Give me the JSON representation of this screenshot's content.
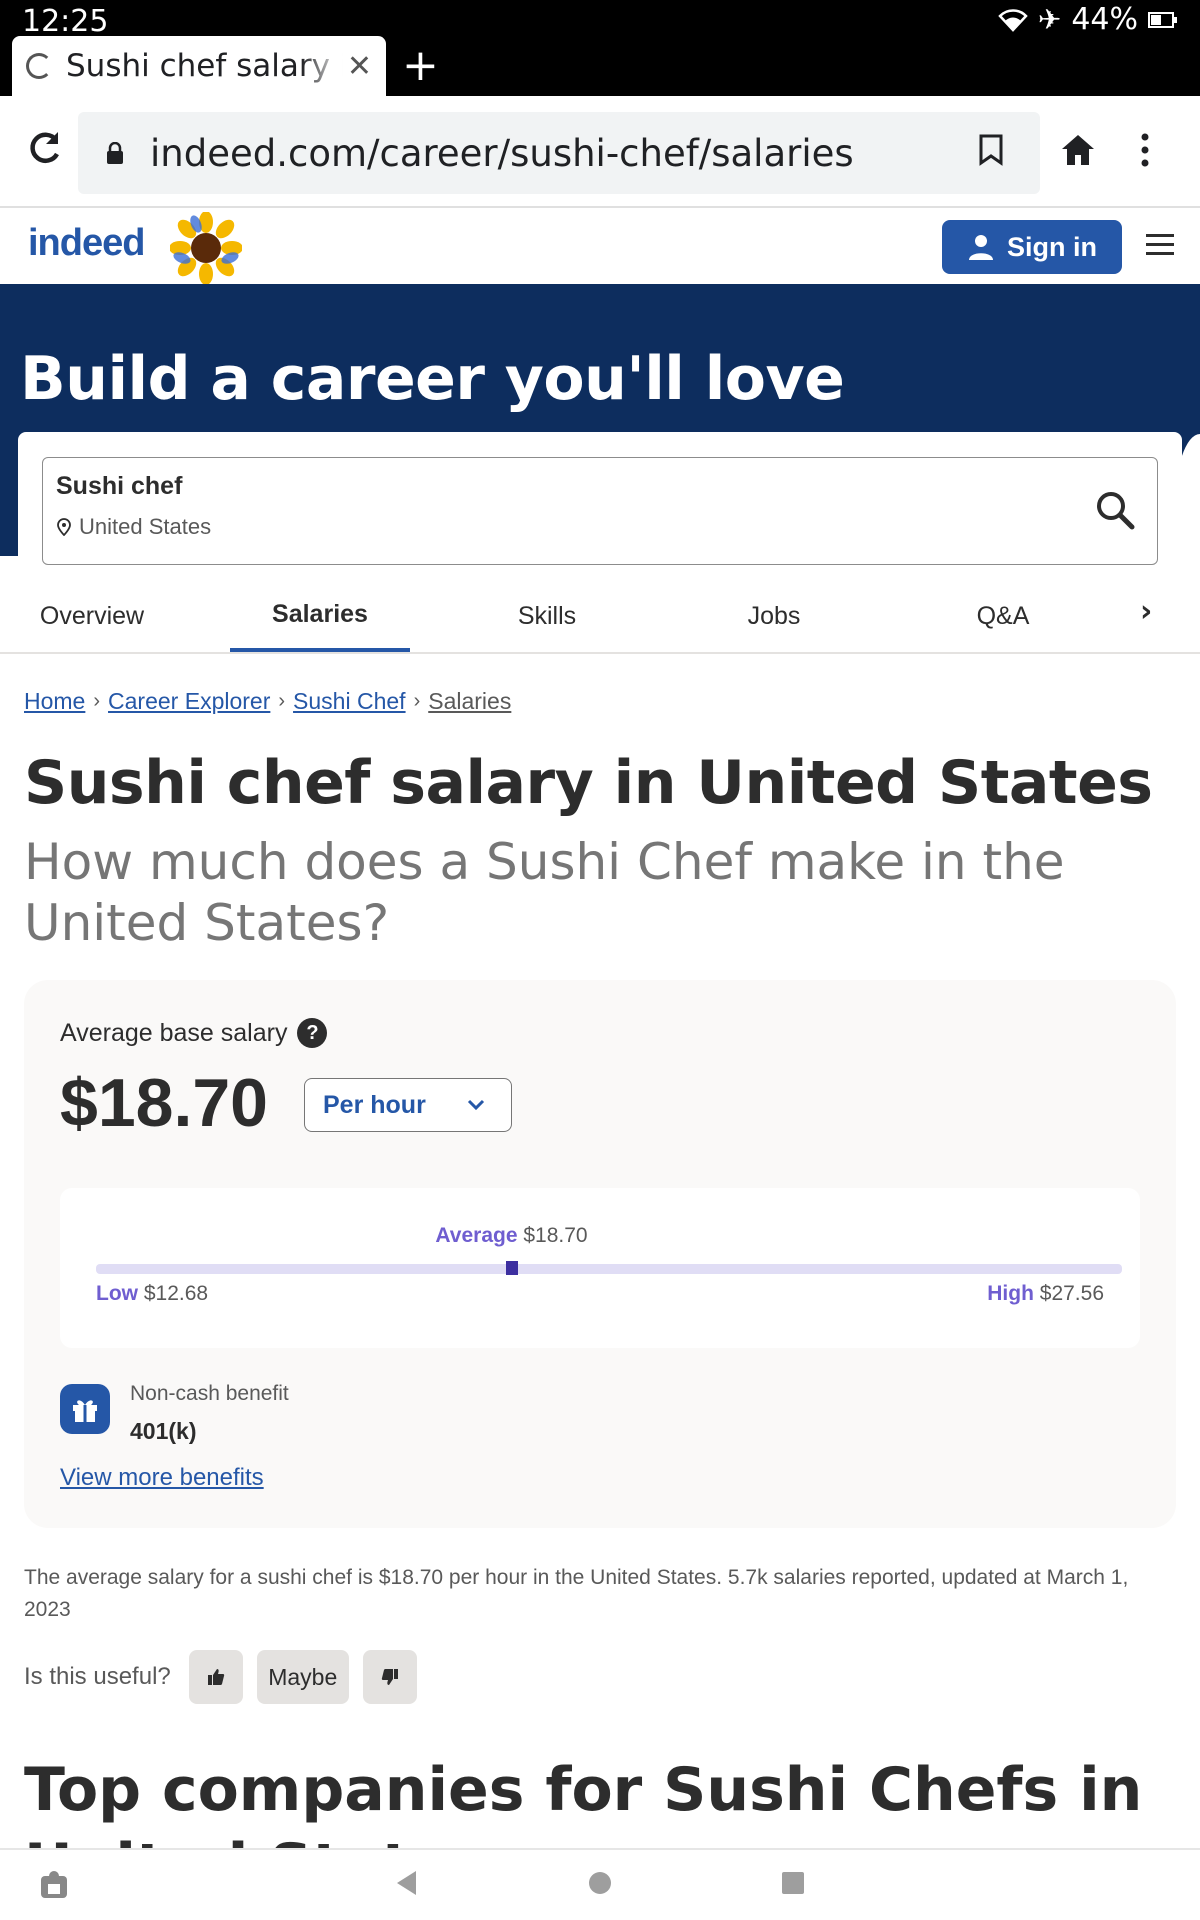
{
  "status": {
    "time": "12:25",
    "battery": "44%"
  },
  "browser": {
    "tab_title": "Sushi chef salary in",
    "url": "indeed.com/career/sushi-chef/salaries"
  },
  "header": {
    "logo": "indeed",
    "signin_label": "Sign in"
  },
  "hero": {
    "title": "Build a career you'll love",
    "search_query": "Sushi chef",
    "search_location": "United States"
  },
  "tabs": [
    {
      "label": "Overview"
    },
    {
      "label": "Salaries"
    },
    {
      "label": "Skills"
    },
    {
      "label": "Jobs"
    },
    {
      "label": "Q&A"
    }
  ],
  "breadcrumb": [
    {
      "label": "Home"
    },
    {
      "label": "Career Explorer"
    },
    {
      "label": "Sushi Chef"
    },
    {
      "label": "Salaries"
    }
  ],
  "page": {
    "title": "Sushi chef salary in United States",
    "subtitle": "How much does a Sushi Chef make in the United States?"
  },
  "salary": {
    "avg_label": "Average base salary",
    "amount": "$18.70",
    "period": "Per hour",
    "avg_word": "Average",
    "avg_value": "$18.70",
    "low_word": "Low",
    "low_value": "$12.68",
    "high_word": "High",
    "high_value": "$27.56",
    "avg_position_fraction": 0.405
  },
  "benefit": {
    "label": "Non-cash benefit",
    "value": "401(k)",
    "more_link": "View more benefits"
  },
  "info": {
    "text": "The average salary for a sushi chef is $18.70 per hour in the United States.  5.7k salaries reported, updated at March 1, 2023"
  },
  "feedback": {
    "question": "Is this useful?",
    "maybe": "Maybe"
  },
  "section": {
    "top_companies": "Top companies for Sushi Chefs in United States"
  },
  "colors": {
    "brand": "#2557a7",
    "hero": "#0d2d5e",
    "range_accent": "#6f5ed0"
  }
}
